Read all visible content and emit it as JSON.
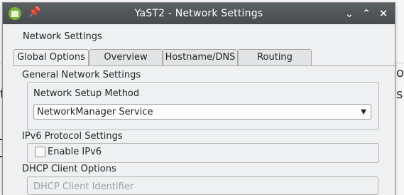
{
  "window": {
    "title": "YaST2 - Network Settings",
    "heading": "Network Settings"
  },
  "tabs": [
    {
      "label": "Global Options",
      "active": true
    },
    {
      "label": "Overview",
      "active": false
    },
    {
      "label": "Hostname/DNS",
      "active": false
    },
    {
      "label": "Routing",
      "active": false
    }
  ],
  "general": {
    "label": "General Network Settings",
    "setup_method_label": "Network Setup Method",
    "setup_method_value": "NetworkManager Service"
  },
  "ipv6": {
    "label": "IPv6 Protocol Settings",
    "enable_label": "Enable IPv6",
    "enabled": false
  },
  "dhcp": {
    "label": "DHCP Client Options",
    "client_identifier_placeholder": "DHCP Client Identifier"
  },
  "background": {
    "glyph_right_1": "o",
    "glyph_right_2": "s",
    "glyph_left": "t"
  },
  "icons": {
    "app": "yast-icon",
    "pin": "pin-icon",
    "minimize": "chevron-down-icon",
    "maximize": "chevron-up-icon",
    "close": "close-icon"
  }
}
